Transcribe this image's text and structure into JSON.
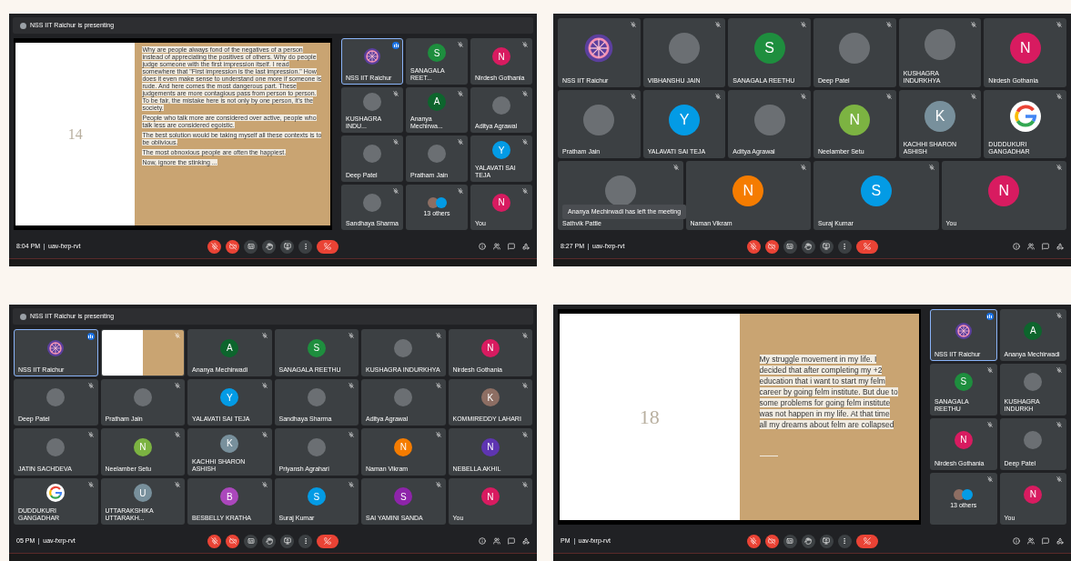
{
  "screens": [
    {
      "kind": "presentation",
      "presenter": "NSS IIT Raichur is presenting",
      "slide": {
        "number": "14",
        "paragraphs": [
          "Why are people always fond of the negatives of a person instead of appreciating the positives of others. Why do people judge someone with the first impression itself. I read somewhere that \"First impression is the last impression.\" How does it even make sense to understand one more if someone is rude. And here comes the most dangerous part. These judgements are more contagious pass from person to person. To be fair, the mistake here is not only by one person, it's the society.",
          "People who talk more are considered over active, people who talk less are considered egoistic.",
          "The best solution would be taking myself all these contexts is to be oblivious.",
          "The most obnoxious people are often the happiest.",
          "Now, ignore the stinking ..."
        ]
      },
      "tile_rows": [
        [
          {
            "kind": "participant",
            "name": "NSS IIT Raichur",
            "selected": true,
            "speaking": true,
            "avatar": {
              "kind": "logo"
            }
          },
          {
            "kind": "participant",
            "name": "SANAGALA REET...",
            "selected": false,
            "speaking": false,
            "avatar": {
              "kind": "letter",
              "letter": "S",
              "color": "#1e8e3e"
            }
          },
          {
            "kind": "participant",
            "name": "Nirdesh Gothania",
            "selected": false,
            "speaking": false,
            "avatar": {
              "kind": "letter",
              "letter": "N",
              "color": "#d81b60"
            }
          }
        ],
        [
          {
            "kind": "participant",
            "name": "KUSHAGRA INDU...",
            "selected": false,
            "speaking": false,
            "avatar": {
              "kind": "photo"
            }
          },
          {
            "kind": "participant",
            "name": "Ananya Mechirwa...",
            "selected": false,
            "speaking": false,
            "avatar": {
              "kind": "letter",
              "letter": "A",
              "color": "#0d652d"
            }
          },
          {
            "kind": "participant",
            "name": "Aditya Agrawal",
            "selected": false,
            "speaking": false,
            "avatar": {
              "kind": "photo"
            }
          }
        ],
        [
          {
            "kind": "participant",
            "name": "Deep Patel",
            "selected": false,
            "speaking": false,
            "avatar": {
              "kind": "photo"
            }
          },
          {
            "kind": "participant",
            "name": "Pratham Jain",
            "selected": false,
            "speaking": false,
            "avatar": {
              "kind": "photo"
            }
          },
          {
            "kind": "participant",
            "name": "YALAVATI SAI TEJA",
            "selected": false,
            "speaking": false,
            "avatar": {
              "kind": "letter",
              "letter": "Y",
              "color": "#039be5"
            }
          }
        ],
        [
          {
            "kind": "participant",
            "name": "Sandhaya Sharma",
            "selected": false,
            "speaking": false,
            "avatar": {
              "kind": "photo"
            }
          },
          {
            "kind": "others",
            "name": "13 others",
            "selected": false,
            "speaking": false
          },
          {
            "kind": "participant",
            "name": "You",
            "selected": false,
            "speaking": false,
            "avatar": {
              "kind": "letter",
              "letter": "N",
              "color": "#d81b60"
            }
          }
        ]
      ],
      "time": "8:04 PM",
      "meeting_code": "uav-fxrp-rvt",
      "mic_on": false,
      "camera_on": false
    },
    {
      "kind": "grid",
      "tile_rows": [
        [
          {
            "kind": "participant",
            "name": "NSS IIT Raichur",
            "selected": false,
            "speaking": false,
            "avatar": {
              "kind": "logo"
            }
          },
          {
            "kind": "participant",
            "name": "VIBHANSHU JAIN",
            "selected": false,
            "speaking": false,
            "avatar": {
              "kind": "photo"
            }
          },
          {
            "kind": "participant",
            "name": "SANAGALA REETHU",
            "selected": false,
            "speaking": false,
            "avatar": {
              "kind": "letter",
              "letter": "S",
              "color": "#1e8e3e"
            }
          },
          {
            "kind": "participant",
            "name": "Deep Patel",
            "selected": false,
            "speaking": false,
            "avatar": {
              "kind": "photo"
            }
          },
          {
            "kind": "participant",
            "name": "KUSHAGRA INDURKHYA",
            "selected": false,
            "speaking": false,
            "avatar": {
              "kind": "photo"
            }
          },
          {
            "kind": "participant",
            "name": "Nirdesh Gothania",
            "selected": false,
            "speaking": false,
            "avatar": {
              "kind": "letter",
              "letter": "N",
              "color": "#d81b60"
            }
          }
        ],
        [
          {
            "kind": "participant",
            "name": "Pratham Jain",
            "selected": false,
            "speaking": false,
            "avatar": {
              "kind": "photo"
            }
          },
          {
            "kind": "participant",
            "name": "YALAVATI SAI TEJA",
            "selected": false,
            "speaking": false,
            "avatar": {
              "kind": "letter",
              "letter": "Y",
              "color": "#039be5"
            }
          },
          {
            "kind": "participant",
            "name": "Aditya Agrawal",
            "selected": false,
            "speaking": false,
            "avatar": {
              "kind": "photo"
            }
          },
          {
            "kind": "participant",
            "name": "Neelamber Setu",
            "selected": false,
            "speaking": false,
            "avatar": {
              "kind": "letter",
              "letter": "N",
              "color": "#7cb342"
            }
          },
          {
            "kind": "participant",
            "name": "KACHHI SHARON ASHISH",
            "selected": false,
            "speaking": false,
            "avatar": {
              "kind": "letter",
              "letter": "K",
              "color": "#78909c"
            }
          },
          {
            "kind": "participant",
            "name": "DUDDUKURI GANGADHAR",
            "selected": false,
            "speaking": false,
            "avatar": {
              "kind": "ring"
            }
          }
        ],
        [
          {
            "kind": "participant",
            "name": "Sathvik Pattle",
            "selected": false,
            "speaking": false,
            "avatar": {
              "kind": "photo"
            }
          },
          {
            "kind": "participant",
            "name": "Naman Vikram",
            "selected": false,
            "speaking": false,
            "avatar": {
              "kind": "letter",
              "letter": "N",
              "color": "#f57c00"
            }
          },
          {
            "kind": "participant",
            "name": "Suraj Kumar",
            "selected": false,
            "speaking": false,
            "avatar": {
              "kind": "letter",
              "letter": "S",
              "color": "#039be5"
            }
          },
          {
            "kind": "participant",
            "name": "You",
            "selected": false,
            "speaking": false,
            "avatar": {
              "kind": "letter",
              "letter": "N",
              "color": "#d81b60"
            }
          }
        ]
      ],
      "toast": "Ananya Mechirwadi has left the meeting",
      "time": "8:27 PM",
      "meeting_code": "uav-fxrp-rvt",
      "mic_on": false,
      "camera_on": false
    },
    {
      "kind": "grid",
      "presenter": "NSS IIT Raichur is presenting",
      "tile_rows": [
        [
          {
            "kind": "participant",
            "name": "NSS IIT Raichur",
            "selected": true,
            "speaking": true,
            "avatar": {
              "kind": "logo"
            }
          },
          {
            "kind": "slide-thumbnail",
            "selected": false,
            "speaking": false
          },
          {
            "kind": "participant",
            "name": "Ananya Mechirwadi",
            "selected": false,
            "speaking": false,
            "avatar": {
              "kind": "letter",
              "letter": "A",
              "color": "#0d652d"
            }
          },
          {
            "kind": "participant",
            "name": "SANAGALA REETHU",
            "selected": false,
            "speaking": false,
            "avatar": {
              "kind": "letter",
              "letter": "S",
              "color": "#1e8e3e"
            }
          },
          {
            "kind": "participant",
            "name": "KUSHAGRA INDURKHYA",
            "selected": false,
            "speaking": false,
            "avatar": {
              "kind": "photo"
            }
          },
          {
            "kind": "participant",
            "name": "Nirdesh Gothania",
            "selected": false,
            "speaking": false,
            "avatar": {
              "kind": "letter",
              "letter": "N",
              "color": "#d81b60"
            }
          }
        ],
        [
          {
            "kind": "participant",
            "name": "Deep Patel",
            "selected": false,
            "speaking": false,
            "avatar": {
              "kind": "photo"
            }
          },
          {
            "kind": "participant",
            "name": "Pratham Jain",
            "selected": false,
            "speaking": false,
            "avatar": {
              "kind": "photo"
            }
          },
          {
            "kind": "participant",
            "name": "YALAVATI SAI TEJA",
            "selected": false,
            "speaking": false,
            "avatar": {
              "kind": "letter",
              "letter": "Y",
              "color": "#039be5"
            }
          },
          {
            "kind": "participant",
            "name": "Sandhaya Sharma",
            "selected": false,
            "speaking": false,
            "avatar": {
              "kind": "photo"
            }
          },
          {
            "kind": "participant",
            "name": "Aditya Agrawal",
            "selected": false,
            "speaking": false,
            "avatar": {
              "kind": "photo"
            }
          },
          {
            "kind": "participant",
            "name": "KOMMIREDDY LAHARI",
            "selected": false,
            "speaking": false,
            "avatar": {
              "kind": "letter",
              "letter": "K",
              "color": "#8d6e63"
            }
          }
        ],
        [
          {
            "kind": "participant",
            "name": "JATIN SACHDEVA",
            "selected": false,
            "speaking": false,
            "avatar": {
              "kind": "photo"
            }
          },
          {
            "kind": "participant",
            "name": "Neelamber Setu",
            "selected": false,
            "speaking": false,
            "avatar": {
              "kind": "letter",
              "letter": "N",
              "color": "#7cb342"
            }
          },
          {
            "kind": "participant",
            "name": "KACHHI SHARON ASHISH",
            "selected": false,
            "speaking": false,
            "avatar": {
              "kind": "letter",
              "letter": "K",
              "color": "#78909c"
            }
          },
          {
            "kind": "participant",
            "name": "Priyansh Agrahari",
            "selected": false,
            "speaking": false,
            "avatar": {
              "kind": "photo"
            }
          },
          {
            "kind": "participant",
            "name": "Naman Vikram",
            "selected": false,
            "speaking": false,
            "avatar": {
              "kind": "letter",
              "letter": "N",
              "color": "#f57c00"
            }
          },
          {
            "kind": "participant",
            "name": "NEBELLA AKHIL",
            "selected": false,
            "speaking": false,
            "avatar": {
              "kind": "letter",
              "letter": "N",
              "color": "#5e35b1"
            }
          }
        ],
        [
          {
            "kind": "participant",
            "name": "DUDDUKURI GANGADHAR",
            "selected": false,
            "speaking": false,
            "avatar": {
              "kind": "ring"
            }
          },
          {
            "kind": "participant",
            "name": "UTTARAKSHIKA UTTARAKH...",
            "selected": false,
            "speaking": false,
            "avatar": {
              "kind": "letter",
              "letter": "U",
              "color": "#78909c"
            }
          },
          {
            "kind": "participant",
            "name": "BESBELLY KRATHA",
            "selected": false,
            "speaking": false,
            "avatar": {
              "kind": "letter",
              "letter": "B",
              "color": "#ab47bc"
            }
          },
          {
            "kind": "participant",
            "name": "Suraj Kumar",
            "selected": false,
            "speaking": false,
            "avatar": {
              "kind": "letter",
              "letter": "S",
              "color": "#039be5"
            }
          },
          {
            "kind": "participant",
            "name": "SAI YAMINI SANDA",
            "selected": false,
            "speaking": false,
            "avatar": {
              "kind": "letter",
              "letter": "S",
              "color": "#8e24aa"
            }
          },
          {
            "kind": "participant",
            "name": "You",
            "selected": false,
            "speaking": false,
            "avatar": {
              "kind": "letter",
              "letter": "N",
              "color": "#d81b60"
            }
          }
        ]
      ],
      "time": "05 PM",
      "meeting_code": "uav-fxrp-rvt",
      "mic_on": false,
      "camera_on": false
    },
    {
      "kind": "presentation",
      "slide": {
        "number": "18",
        "paragraphs": [
          "My struggle movement in my life. I decided that after completing my +2 education that i want to start my felm career by going felm institute. But due to some problems for going felm institute was not happen in my life. At that time all my dreams about felm are collapsed"
        ]
      },
      "tile_rows": [
        [
          {
            "kind": "participant",
            "name": "NSS IIT Raichur",
            "selected": true,
            "speaking": true,
            "avatar": {
              "kind": "logo"
            }
          },
          {
            "kind": "participant",
            "name": "Ananya Mechirwadi",
            "selected": false,
            "speaking": false,
            "avatar": {
              "kind": "letter",
              "letter": "A",
              "color": "#0d652d"
            }
          }
        ],
        [
          {
            "kind": "participant",
            "name": "SANAGALA REETHU",
            "selected": false,
            "speaking": false,
            "avatar": {
              "kind": "letter",
              "letter": "S",
              "color": "#1e8e3e"
            }
          },
          {
            "kind": "participant",
            "name": "KUSHAGRA INDURKH",
            "selected": false,
            "speaking": false,
            "avatar": {
              "kind": "photo"
            }
          }
        ],
        [
          {
            "kind": "participant",
            "name": "Nirdesh Gothania",
            "selected": false,
            "speaking": false,
            "avatar": {
              "kind": "letter",
              "letter": "N",
              "color": "#d81b60"
            }
          },
          {
            "kind": "participant",
            "name": "Deep Patel",
            "selected": false,
            "speaking": false,
            "avatar": {
              "kind": "photo"
            }
          }
        ],
        [
          {
            "kind": "others",
            "name": "13 others",
            "selected": false,
            "speaking": false
          },
          {
            "kind": "participant",
            "name": "You",
            "selected": false,
            "speaking": false,
            "avatar": {
              "kind": "letter",
              "letter": "N",
              "color": "#d81b60"
            }
          }
        ]
      ],
      "time": "PM",
      "meeting_code": "uav-fxrp-rvt",
      "mic_on": false,
      "camera_on": false
    }
  ]
}
